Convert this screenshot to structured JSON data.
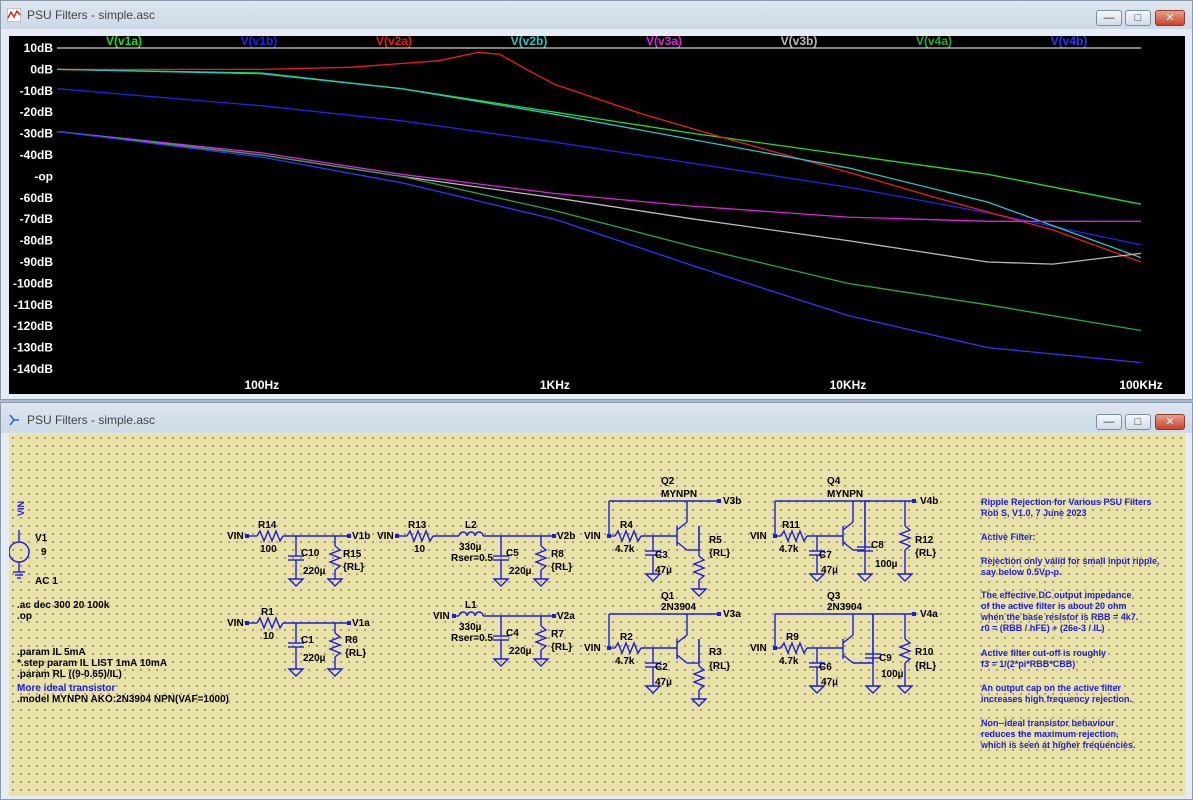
{
  "waveform_window": {
    "title": "PSU Filters - simple.asc",
    "buttons": {
      "minimize": "—",
      "maximize": "□",
      "close": "✕"
    }
  },
  "schematic_window": {
    "title": "PSU Filters - simple.asc",
    "buttons": {
      "minimize": "—",
      "maximize": "□",
      "close": "✕"
    }
  },
  "colors": {
    "v1a": "#22dd22",
    "v1b": "#2222ee",
    "v2a": "#ee1c1c",
    "v2b": "#20c8c8",
    "v3a": "#e020e0",
    "v3b": "#bbbbbb",
    "v4a": "#22aa44",
    "v4b": "#3333ff"
  },
  "chart_data": {
    "type": "line",
    "x_scale": "log",
    "xlim": [
      20,
      100000
    ],
    "ylim": [
      -140,
      10
    ],
    "grid": false,
    "legend_position": "top",
    "y_ticks": [
      "10dB",
      "0dB",
      "-10dB",
      "-20dB",
      "-30dB",
      "-40dB",
      "-op",
      "-60dB",
      "-70dB",
      "-80dB",
      "-90dB",
      "-100dB",
      "-110dB",
      "-120dB",
      "-130dB",
      "-140dB"
    ],
    "x_ticks": [
      "100Hz",
      "1KHz",
      "10KHz",
      "100KHz"
    ],
    "series": [
      {
        "name": "V(v1a)",
        "color": "#22dd22",
        "points": [
          [
            20,
            0
          ],
          [
            100,
            -1.7
          ],
          [
            300,
            -9
          ],
          [
            1000,
            -20
          ],
          [
            3000,
            -30
          ],
          [
            10000,
            -40
          ],
          [
            30000,
            -49
          ],
          [
            100000,
            -63
          ]
        ]
      },
      {
        "name": "V(v1b)",
        "color": "#2222ee",
        "points": [
          [
            20,
            -9
          ],
          [
            100,
            -17
          ],
          [
            300,
            -24
          ],
          [
            1000,
            -34
          ],
          [
            3000,
            -44
          ],
          [
            10000,
            -55
          ],
          [
            30000,
            -67
          ],
          [
            100000,
            -82
          ]
        ]
      },
      {
        "name": "V(v2a)",
        "color": "#ee1c1c",
        "points": [
          [
            20,
            0
          ],
          [
            100,
            0
          ],
          [
            200,
            1
          ],
          [
            400,
            4
          ],
          [
            550,
            8
          ],
          [
            650,
            7
          ],
          [
            800,
            0
          ],
          [
            1000,
            -7
          ],
          [
            2000,
            -21
          ],
          [
            4000,
            -33
          ],
          [
            10000,
            -48
          ],
          [
            20000,
            -60
          ],
          [
            50000,
            -75
          ],
          [
            100000,
            -90
          ]
        ]
      },
      {
        "name": "V(v2b)",
        "color": "#20c8c8",
        "points": [
          [
            20,
            0
          ],
          [
            100,
            -2
          ],
          [
            300,
            -9
          ],
          [
            1000,
            -21
          ],
          [
            3000,
            -33
          ],
          [
            10000,
            -46
          ],
          [
            30000,
            -62
          ],
          [
            100000,
            -88
          ]
        ]
      },
      {
        "name": "V(v3a)",
        "color": "#e020e0",
        "points": [
          [
            20,
            -29
          ],
          [
            100,
            -39
          ],
          [
            300,
            -49
          ],
          [
            1000,
            -58
          ],
          [
            3000,
            -64
          ],
          [
            10000,
            -69
          ],
          [
            30000,
            -71
          ],
          [
            100000,
            -71
          ]
        ]
      },
      {
        "name": "V(v3b)",
        "color": "#bbbbbb",
        "points": [
          [
            20,
            -29
          ],
          [
            100,
            -40
          ],
          [
            300,
            -50
          ],
          [
            1000,
            -60
          ],
          [
            3000,
            -70
          ],
          [
            10000,
            -80
          ],
          [
            30000,
            -90
          ],
          [
            50000,
            -91
          ],
          [
            100000,
            -86
          ]
        ]
      },
      {
        "name": "V(v4a)",
        "color": "#22aa44",
        "points": [
          [
            20,
            -29
          ],
          [
            100,
            -40
          ],
          [
            300,
            -50
          ],
          [
            1000,
            -66
          ],
          [
            3000,
            -83
          ],
          [
            10000,
            -100
          ],
          [
            30000,
            -110
          ],
          [
            100000,
            -122
          ]
        ]
      },
      {
        "name": "V(v4b)",
        "color": "#3333ff",
        "points": [
          [
            20,
            -29
          ],
          [
            100,
            -41
          ],
          [
            300,
            -53
          ],
          [
            1000,
            -70
          ],
          [
            3000,
            -92
          ],
          [
            10000,
            -115
          ],
          [
            30000,
            -130
          ],
          [
            100000,
            -137
          ]
        ]
      }
    ]
  },
  "schematic": {
    "source": {
      "name": "V1",
      "value": "9",
      "ac": "AC 1",
      "net": "VIN"
    },
    "directives": [
      ".ac dec 300 20 100k",
      ".op"
    ],
    "params": [
      ".param IL 5mA",
      "*.step param IL LIST 1mA 10mA",
      ".param RL ((9-0.65)/IL)"
    ],
    "model_comment": "More ideal transistor",
    "model": ".model MYNPN AKO:2N3904 NPN(VAF=1000)",
    "labels": {
      "vin": "VIN",
      "r14": "R14",
      "r14v": "100",
      "c10": "C10",
      "c10v": "220µ",
      "r15": "R15",
      "r15v": "{RL}",
      "v1b": "V1b",
      "r1": "R1",
      "r1v": "10",
      "c1": "C1",
      "c1v": "220µ",
      "r6": "R6",
      "r6v": "{RL}",
      "v1a": "V1a",
      "r13": "R13",
      "r13v": "10",
      "l2": "L2",
      "l2v": "330µ",
      "rser2": "Rser=0.5",
      "c5": "C5",
      "c5v": "220µ",
      "r8": "R8",
      "r8v": "{RL}",
      "v2b": "V2b",
      "l1": "L1",
      "l1v": "330µ",
      "rser1": "Rser=0.5",
      "c4": "C4",
      "c4v": "220µ",
      "r7": "R7",
      "r7v": "{RL}",
      "v2a": "V2a",
      "q2": "Q2",
      "q2m": "MYNPN",
      "r4": "R4",
      "r4v": "4.7k",
      "c3": "C3",
      "c3v": "47µ",
      "r5": "R5",
      "r5v": "{RL}",
      "v3b": "V3b",
      "q1": "Q1",
      "q1m": "2N3904",
      "r2": "R2",
      "r2v": "4.7k",
      "c2": "C2",
      "c2v": "47µ",
      "r3": "R3",
      "r3v": "{RL}",
      "v3a": "V3a",
      "q4": "Q4",
      "q4m": "MYNPN",
      "r11": "R11",
      "r11v": "4.7k",
      "c7": "C7",
      "c7v": "47µ",
      "c8": "C8",
      "c8v": "100µ",
      "r12": "R12",
      "r12v": "{RL}",
      "v4b": "V4b",
      "q3": "Q3",
      "q3m": "2N3904",
      "r9": "R9",
      "r9v": "4.7k",
      "c6": "C6",
      "c6v": "47µ",
      "c9": "C9",
      "c9v": "100µ",
      "r10": "R10",
      "r10v": "{RL}",
      "v4a": "V4a"
    },
    "notes": [
      "Ripple Rejection for Various PSU Filters",
      "Rob S, V1.0, 7 June 2023",
      "Active Filter:",
      "Rejection only valid for small input ripple,",
      "say below 0.5Vp-p.",
      "The effective DC output impedance",
      "of the active filter is about 20 ohm",
      "when the base resistor is RBB = 4k7.",
      "r0 = (RBB / hFE) + (26e-3 / IL)",
      "Active filter cut-off is roughly",
      "f3 = 1/(2*pi*RBB*CBB)",
      "An output cap on the active filter",
      "increases high frequency rejection.",
      "Non--ideal transistor behaviour",
      "reduces the maximum rejection,",
      "which is seen at higher frequencies."
    ]
  }
}
